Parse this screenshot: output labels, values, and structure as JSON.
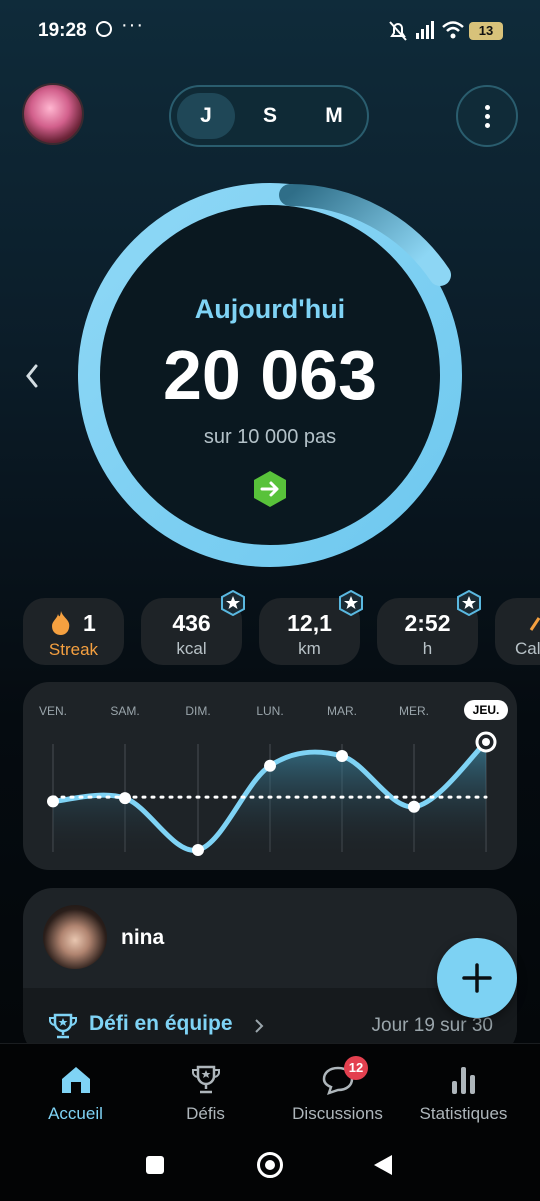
{
  "status_bar": {
    "time": "19:28",
    "battery": "13"
  },
  "range_selector": {
    "options": [
      "J",
      "S",
      "M"
    ],
    "selected": "J"
  },
  "today": {
    "label": "Aujourd'hui",
    "steps": "20 063",
    "goal_text": "sur 10 000 pas",
    "progress": 2.0063
  },
  "stats": {
    "streak": {
      "value": "1",
      "label": "Streak"
    },
    "calories": {
      "value": "436",
      "label": "kcal"
    },
    "distance": {
      "value": "12,1",
      "label": "km"
    },
    "duration": {
      "value": "2:52",
      "label": "h"
    },
    "extra": {
      "label": "Cal"
    }
  },
  "week": {
    "days": [
      "VEN.",
      "SAM.",
      "DIM.",
      "LUN.",
      "MAR.",
      "MER.",
      "JEU."
    ],
    "selected": "JEU.",
    "relative_values": [
      0.45,
      0.48,
      0.0,
      0.78,
      0.87,
      0.4,
      1.0
    ],
    "average_relative": 0.49
  },
  "friend": {
    "name": "nina",
    "challenge": "Défi en équipe",
    "challenge_day": "Jour 19 sur 30"
  },
  "bottom_nav": {
    "items": [
      {
        "label": "Accueil",
        "icon": "home-icon",
        "active": true
      },
      {
        "label": "Défis",
        "icon": "trophy-icon",
        "active": false
      },
      {
        "label": "Discussions",
        "icon": "chat-icon",
        "active": false,
        "badge": "12"
      },
      {
        "label": "Statistiques",
        "icon": "bar-chart-icon",
        "active": false
      }
    ]
  },
  "colors": {
    "accent": "#7fd3f5",
    "streak": "#f5a040",
    "badge": "#e3404f"
  }
}
